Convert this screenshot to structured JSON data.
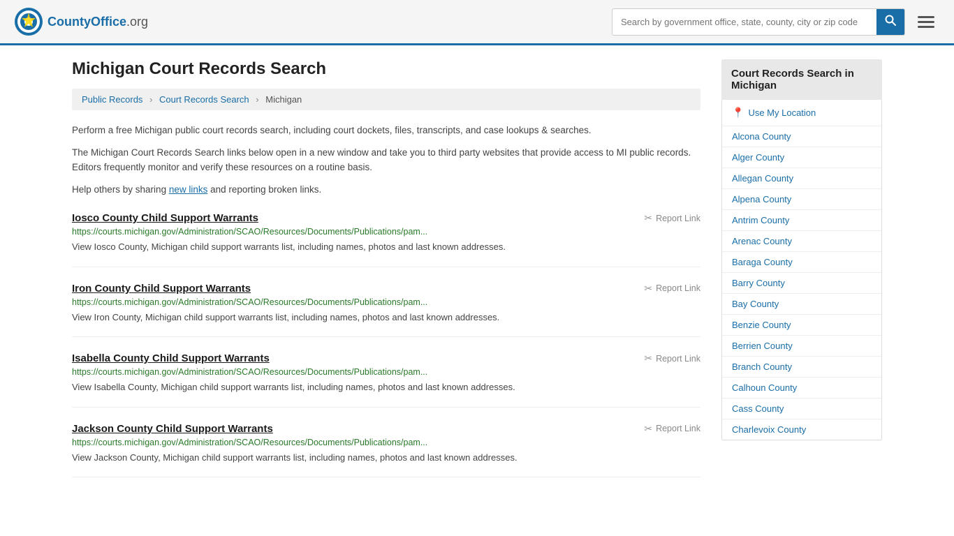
{
  "header": {
    "logo_text": "CountyOffice",
    "logo_suffix": ".org",
    "search_placeholder": "Search by government office, state, county, city or zip code",
    "search_value": ""
  },
  "page": {
    "title": "Michigan Court Records Search",
    "breadcrumb": [
      {
        "label": "Public Records",
        "href": "#"
      },
      {
        "label": "Court Records Search",
        "href": "#"
      },
      {
        "label": "Michigan",
        "href": "#"
      }
    ],
    "description1": "Perform a free Michigan public court records search, including court dockets, files, transcripts, and case lookups & searches.",
    "description2": "The Michigan Court Records Search links below open in a new window and take you to third party websites that provide access to MI public records. Editors frequently monitor and verify these resources on a routine basis.",
    "description3_prefix": "Help others by sharing ",
    "new_links_text": "new links",
    "description3_suffix": " and reporting broken links."
  },
  "results": [
    {
      "title": "Iosco County Child Support Warrants",
      "url": "https://courts.michigan.gov/Administration/SCAO/Resources/Documents/Publications/pam...",
      "description": "View Iosco County, Michigan child support warrants list, including names, photos and last known addresses.",
      "report_label": "Report Link"
    },
    {
      "title": "Iron County Child Support Warrants",
      "url": "https://courts.michigan.gov/Administration/SCAO/Resources/Documents/Publications/pam...",
      "description": "View Iron County, Michigan child support warrants list, including names, photos and last known addresses.",
      "report_label": "Report Link"
    },
    {
      "title": "Isabella County Child Support Warrants",
      "url": "https://courts.michigan.gov/Administration/SCAO/Resources/Documents/Publications/pam...",
      "description": "View Isabella County, Michigan child support warrants list, including names, photos and last known addresses.",
      "report_label": "Report Link"
    },
    {
      "title": "Jackson County Child Support Warrants",
      "url": "https://courts.michigan.gov/Administration/SCAO/Resources/Documents/Publications/pam...",
      "description": "View Jackson County, Michigan child support warrants list, including names, photos and last known addresses.",
      "report_label": "Report Link"
    }
  ],
  "sidebar": {
    "title": "Court Records Search in Michigan",
    "use_location_label": "Use My Location",
    "counties": [
      "Alcona County",
      "Alger County",
      "Allegan County",
      "Alpena County",
      "Antrim County",
      "Arenac County",
      "Baraga County",
      "Barry County",
      "Bay County",
      "Benzie County",
      "Berrien County",
      "Branch County",
      "Calhoun County",
      "Cass County",
      "Charlevoix County"
    ]
  }
}
